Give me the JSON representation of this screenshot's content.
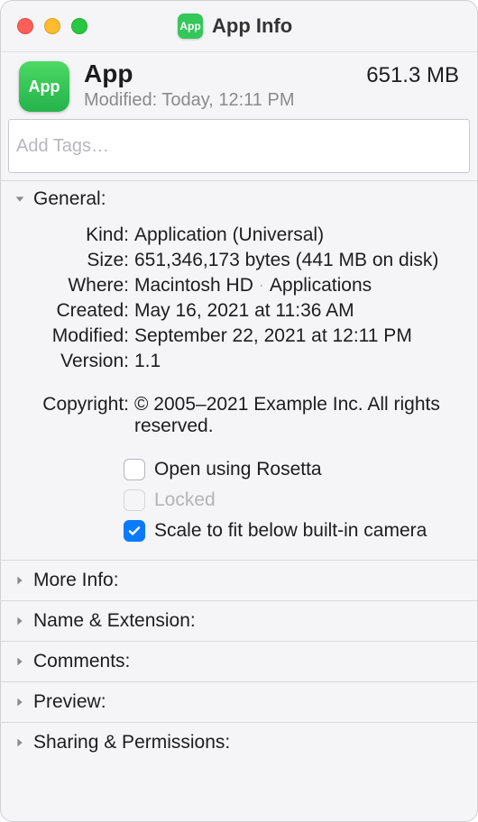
{
  "window_title": "App Info",
  "header": {
    "app_name": "App",
    "modified_label": "Modified:",
    "modified_value": "Today, 12:11 PM",
    "size": "651.3 MB",
    "icon_text": "App"
  },
  "tags": {
    "placeholder": "Add Tags…"
  },
  "general": {
    "title": "General:",
    "rows": {
      "kind_label": "Kind:",
      "kind_value": "Application (Universal)",
      "size_label": "Size:",
      "size_value": "651,346,173 bytes (441 MB on disk)",
      "where_label": "Where:",
      "where_part1": "Macintosh HD",
      "where_part2": "Applications",
      "created_label": "Created:",
      "created_value": "May 16, 2021 at 11:36 AM",
      "modified_label": "Modified:",
      "modified_value": "September 22, 2021 at 12:11 PM",
      "version_label": "Version:",
      "version_value": "1.1",
      "copyright_label": "Copyright:",
      "copyright_value": "© 2005–2021 Example Inc. All rights reserved."
    },
    "checks": {
      "rosetta": "Open using Rosetta",
      "locked": "Locked",
      "scale": "Scale to fit below built-in camera"
    }
  },
  "collapsed_sections": {
    "more_info": "More Info:",
    "name_ext": "Name & Extension:",
    "comments": "Comments:",
    "preview": "Preview:",
    "sharing": "Sharing & Permissions:"
  }
}
